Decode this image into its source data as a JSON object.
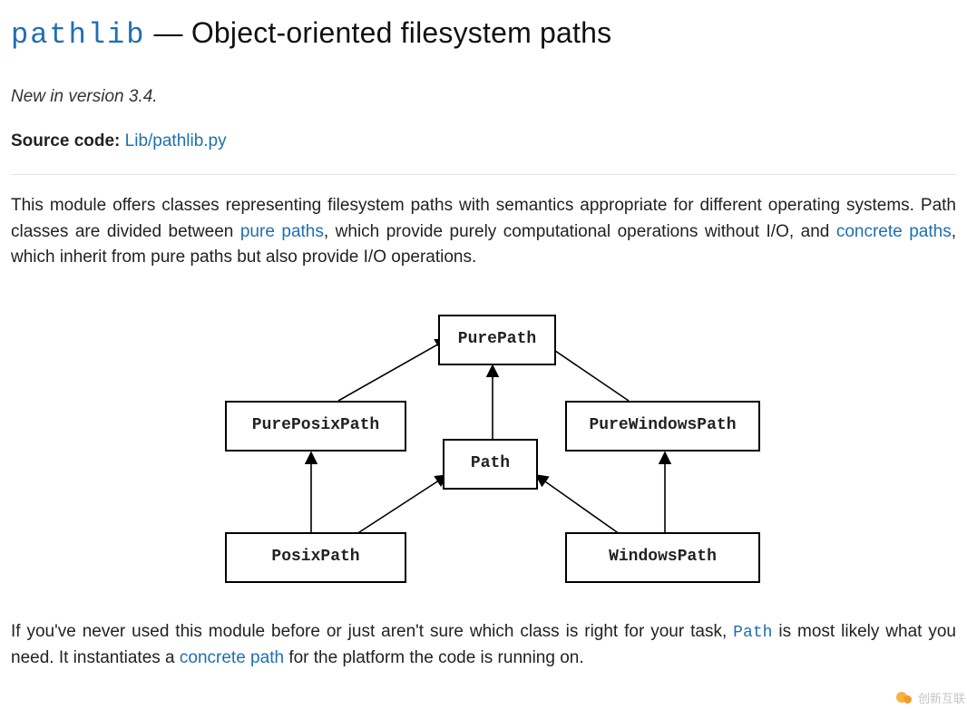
{
  "heading": {
    "module": "pathlib",
    "dash": " — ",
    "title": "Object-oriented filesystem paths"
  },
  "version_note": "New in version 3.4.",
  "source": {
    "label": "Source code:",
    "link_text": "Lib/pathlib.py"
  },
  "intro": {
    "p1a": "This module offers classes representing filesystem paths with semantics appropriate for different operating systems. Path classes are divided between ",
    "link_pure": "pure paths",
    "p1b": ", which provide purely computational operations without I/O, and ",
    "link_concrete": "concrete paths",
    "p1c": ", which inherit from pure paths but also provide I/O operations."
  },
  "diagram": {
    "nodes": {
      "purepath": "PurePath",
      "pureposix": "PurePosixPath",
      "purewindows": "PureWindowsPath",
      "path": "Path",
      "posix": "PosixPath",
      "windows": "WindowsPath"
    }
  },
  "outro": {
    "p2a": "If you've never used this module before or just aren't sure which class is right for your task, ",
    "code_path": "Path",
    "p2b": " is most likely what you need. It instantiates a ",
    "link_concrete2": "concrete path",
    "p2c": " for the platform the code is running on."
  },
  "watermark": "创新互联"
}
